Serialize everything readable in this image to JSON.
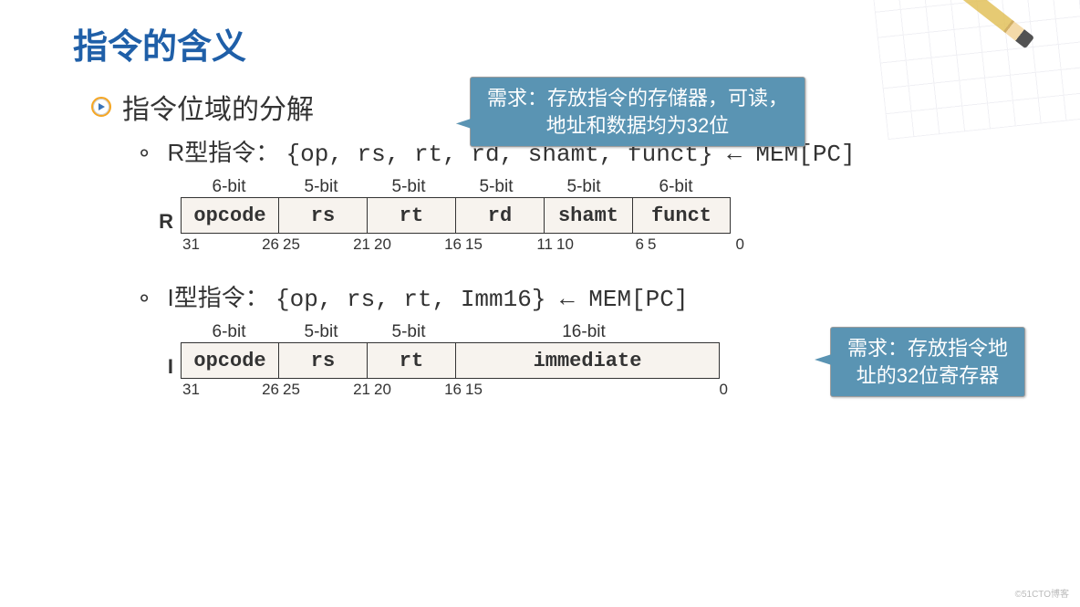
{
  "title": "指令的含义",
  "main_bullet": "指令位域的分解",
  "callout1": {
    "line1": "需求：存放指令的存储器，可读，",
    "line2": "地址和数据均为32位"
  },
  "callout2": {
    "line1": "需求：存放指令地",
    "line2": "址的32位寄存器"
  },
  "r_section": {
    "label": "R型指令：",
    "code": "{op, rs, rt, rd, shamt, funct} ← MEM[PC]",
    "row_label": "R",
    "top": [
      "6-bit",
      "5-bit",
      "5-bit",
      "5-bit",
      "5-bit",
      "6-bit"
    ],
    "fields": [
      "opcode",
      "rs",
      "rt",
      "rd",
      "shamt",
      "funct"
    ],
    "bits": [
      [
        "31",
        "26"
      ],
      [
        "25",
        "21"
      ],
      [
        "20",
        "16"
      ],
      [
        "15",
        "11"
      ],
      [
        "10",
        "6"
      ],
      [
        "5",
        "0"
      ]
    ]
  },
  "i_section": {
    "label": "I型指令：",
    "code": "{op, rs, rt, Imm16} ← MEM[PC]",
    "row_label": "I",
    "top": [
      "6-bit",
      "5-bit",
      "5-bit",
      "16-bit"
    ],
    "fields": [
      "opcode",
      "rs",
      "rt",
      "immediate"
    ],
    "bits": [
      [
        "31",
        "26"
      ],
      [
        "25",
        "21"
      ],
      [
        "20",
        "16"
      ],
      [
        "15",
        "0"
      ]
    ]
  },
  "watermark": "©51CTO博客"
}
